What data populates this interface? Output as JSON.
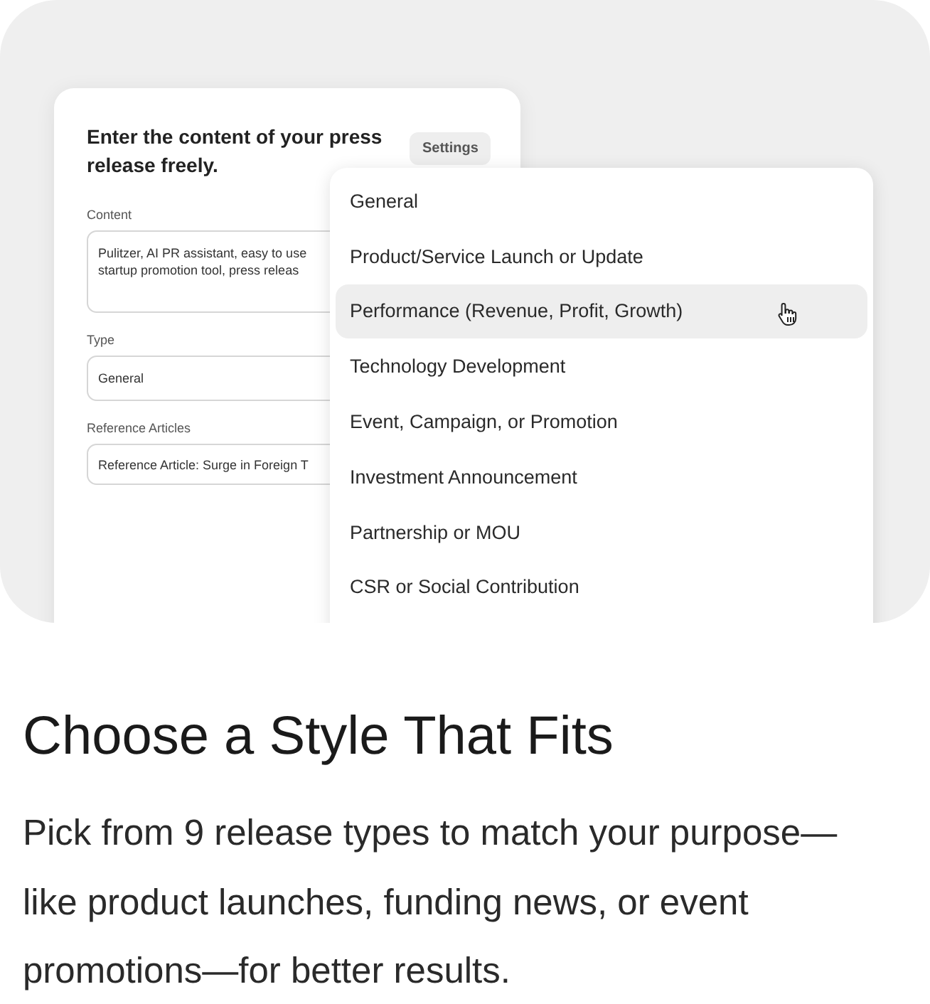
{
  "form_card": {
    "title": "Enter the content of your press release freely.",
    "settings_button": "Settings",
    "fields": [
      {
        "label": "Content",
        "kind": "textarea",
        "value": "Pulitzer, AI PR assistant, easy to use startup promotion tool, press releas"
      },
      {
        "label": "Type",
        "kind": "select",
        "value": "General"
      },
      {
        "label": "Reference Articles",
        "kind": "input",
        "value": "Reference Article: Surge in Foreign T"
      }
    ]
  },
  "type_dropdown": {
    "options": [
      {
        "label": "General",
        "selected": false
      },
      {
        "label": "Product/Service Launch or Update",
        "selected": false
      },
      {
        "label": "Performance (Revenue, Profit, Growth)",
        "selected": true
      },
      {
        "label": "Technology Development",
        "selected": false
      },
      {
        "label": "Event, Campaign, or Promotion",
        "selected": false
      },
      {
        "label": "Investment Announcement",
        "selected": false
      },
      {
        "label": "Partnership or MOU",
        "selected": false
      },
      {
        "label": "CSR or Social Contribution",
        "selected": false
      }
    ]
  },
  "heading": "Choose a Style That Fits",
  "description": "Pick from 9 release types to match your purpose—like product launches, funding news, or event promotions—for better results."
}
